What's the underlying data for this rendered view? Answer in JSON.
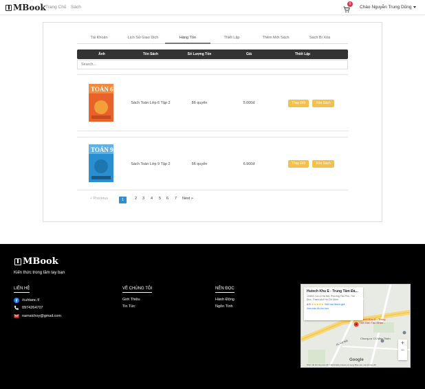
{
  "header": {
    "brand": "MBook",
    "nav": [
      "Trang Chủ",
      "Sách"
    ],
    "cart_count": "0",
    "greeting": "Chào Nguyễn Trung Dũng"
  },
  "tabs": [
    {
      "label": "Tài Khoản",
      "active": false
    },
    {
      "label": "Lịch Sử Giao Dịch",
      "active": false
    },
    {
      "label": "Hàng Tồn",
      "active": true
    },
    {
      "label": "Thiết Lập",
      "active": false
    },
    {
      "label": "Thêm Mới Sách",
      "active": false
    },
    {
      "label": "Sách Bị Xóa",
      "active": false
    }
  ],
  "table": {
    "headers": [
      "Ảnh",
      "Tên Sách",
      "Số Lượng Tồn",
      "Giá",
      "Thiết Lập"
    ],
    "search_placeholder": "Search...",
    "rows": [
      {
        "cover_text": "TOÁN 6",
        "cover_color": "#e9622a",
        "name": "Sách Toán Lớp 6 Tập 2",
        "quantity": "86 quyển",
        "price": "5.000đ",
        "edit_label": "Thay Đổi",
        "delete_label": "Xóa Sách"
      },
      {
        "cover_text": "TOÁN 9",
        "cover_color": "#2a8fd0",
        "name": "Sách Toán Lớp 9 Tập 2",
        "quantity": "56 quyển",
        "price": "6.900đ",
        "edit_label": "Thay Đổi",
        "delete_label": "Xóa Sách"
      }
    ]
  },
  "pagination": {
    "previous": "« Previous",
    "pages": [
      "1",
      "2",
      "3",
      "4",
      "5",
      "6",
      "7"
    ],
    "active": "1",
    "next": "Next »"
  },
  "footer": {
    "brand": "MBook",
    "tagline": "Kiến thức trong tầm tay bạn",
    "contact": {
      "heading": "LIÊN HỆ",
      "facebook": "/cuhtanc.f/",
      "phone": "0974264707",
      "email": "namsichoy@gmail.com"
    },
    "about": {
      "heading": "VỀ CHÚNG TÔI",
      "items": [
        "Giới Thiệu",
        "Tin Tức"
      ]
    },
    "read": {
      "heading": "NÊN ĐỌC",
      "items": [
        "Hành Động",
        "Ngôn Tình"
      ]
    },
    "map": {
      "place_title": "Hutech Khu E - Trung Tâm Đà...",
      "address": "10/80C Xa Lộ Hà Nội, Phường Tân Phú, Thủ Đức, Thành phố Hồ Chí Minh",
      "rating": "4.5",
      "stars": "★★★★★",
      "reviews": "346 bài đánh giá",
      "larger_map": "Xem bản đồ lớn hơn",
      "poi_main": "Hutech Khu E - Trung Tâm Đào Tạo Nhân...",
      "poi_apartment": "Chung cư C1 Man Thiện",
      "road": "XL Hà Nội",
      "google": "Google",
      "footer_text": "Phím tắt  Dữ liệu bản đồ ©2022  Điều khoản sử dụng  Báo cáo một lỗi bản đồ"
    }
  }
}
